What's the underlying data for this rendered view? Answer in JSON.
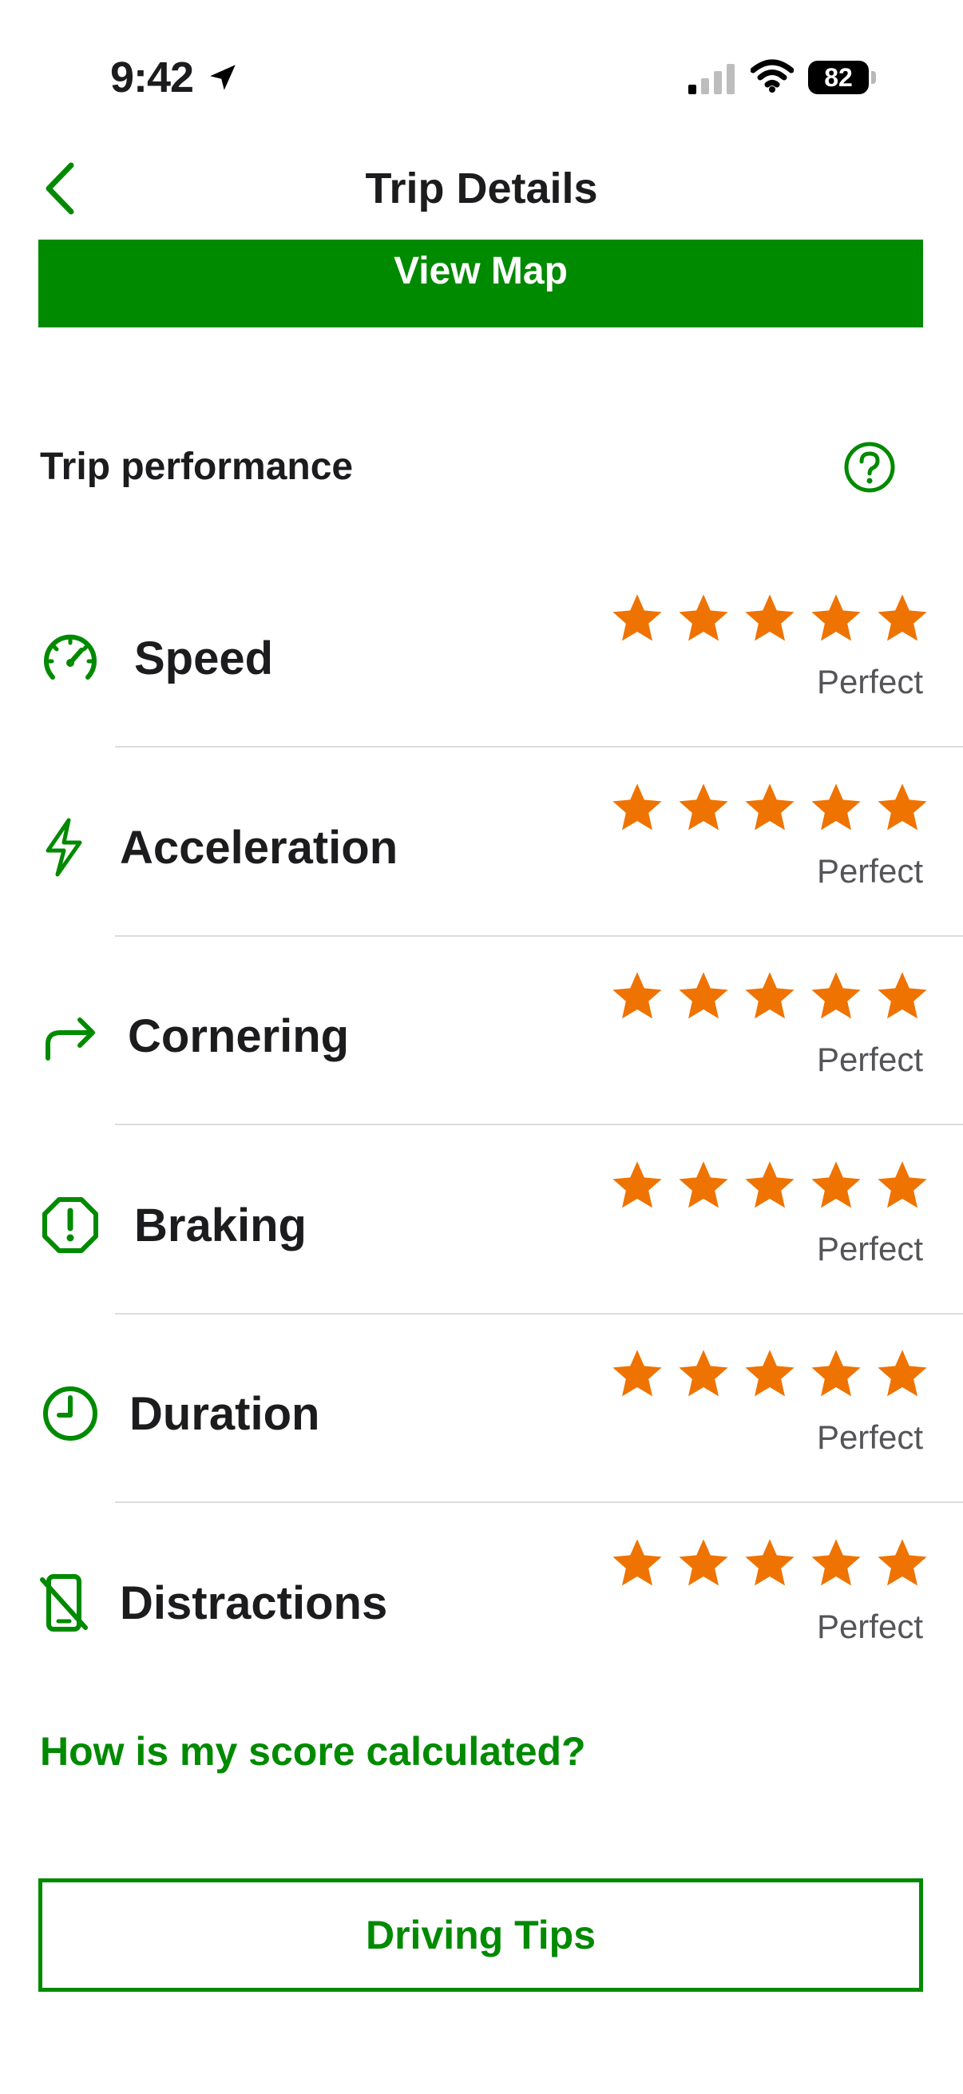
{
  "status_bar": {
    "time": "9:42",
    "battery": "82"
  },
  "nav": {
    "title": "Trip Details"
  },
  "view_map_label": "View Map",
  "section": {
    "title": "Trip performance"
  },
  "metrics": [
    {
      "label": "Speed",
      "rating": "Perfect",
      "stars": 5,
      "icon": "speedometer-icon"
    },
    {
      "label": "Acceleration",
      "rating": "Perfect",
      "stars": 5,
      "icon": "lightning-bolt-icon"
    },
    {
      "label": "Cornering",
      "rating": "Perfect",
      "stars": 5,
      "icon": "turn-right-arrow-icon"
    },
    {
      "label": "Braking",
      "rating": "Perfect",
      "stars": 5,
      "icon": "alert-octagon-icon"
    },
    {
      "label": "Duration",
      "rating": "Perfect",
      "stars": 5,
      "icon": "clock-icon"
    },
    {
      "label": "Distractions",
      "rating": "Perfect",
      "stars": 5,
      "icon": "phone-off-icon"
    }
  ],
  "score_link": "How is my score calculated?",
  "driving_tips_label": "Driving Tips",
  "colors": {
    "brand_green": "#008a00",
    "star_orange": "#ef7300",
    "text_dark": "#1c1c1e",
    "text_muted": "#555559"
  }
}
